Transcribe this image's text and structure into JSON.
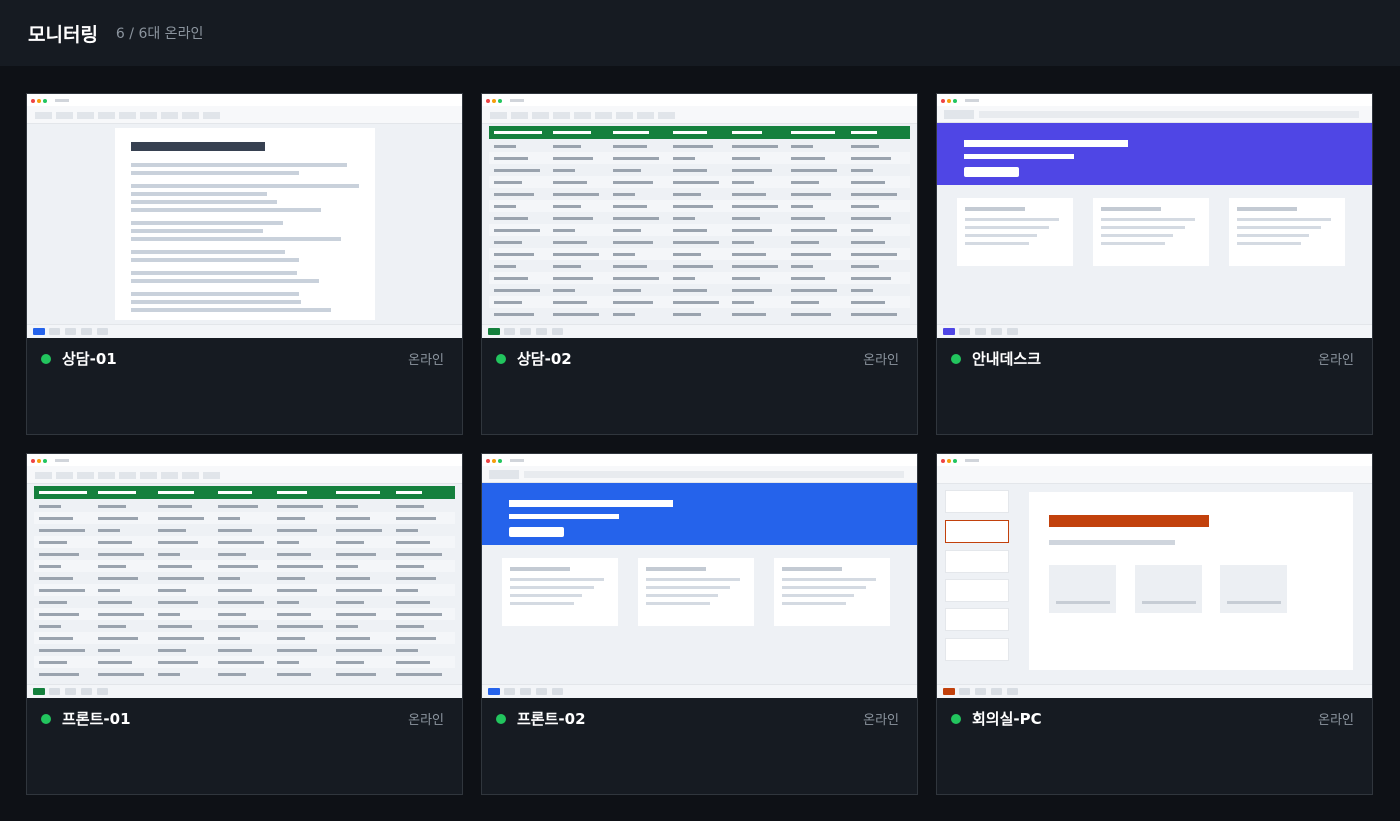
{
  "header": {
    "title": "모니터링",
    "online_count": "6 / 6대 온라인"
  },
  "colors": {
    "status_online": "#22c55e",
    "spreadsheet_green": "#15803d",
    "dashboard_indigo": "#4f46e5",
    "dashboard_blue": "#2563eb",
    "slides_orange": "#c2410c"
  },
  "devices": [
    {
      "name": "상담-01",
      "status": "온라인",
      "screen": "document",
      "accent": "#2563eb"
    },
    {
      "name": "상담-02",
      "status": "온라인",
      "screen": "spreadsheet",
      "accent": "#15803d"
    },
    {
      "name": "안내데스크",
      "status": "온라인",
      "screen": "dashboard",
      "accent": "#4f46e5"
    },
    {
      "name": "프론트-01",
      "status": "온라인",
      "screen": "spreadsheet",
      "accent": "#15803d"
    },
    {
      "name": "프론트-02",
      "status": "온라인",
      "screen": "dashboard",
      "accent": "#2563eb"
    },
    {
      "name": "회의실-PC",
      "status": "온라인",
      "screen": "slides",
      "accent": "#c2410c"
    }
  ]
}
